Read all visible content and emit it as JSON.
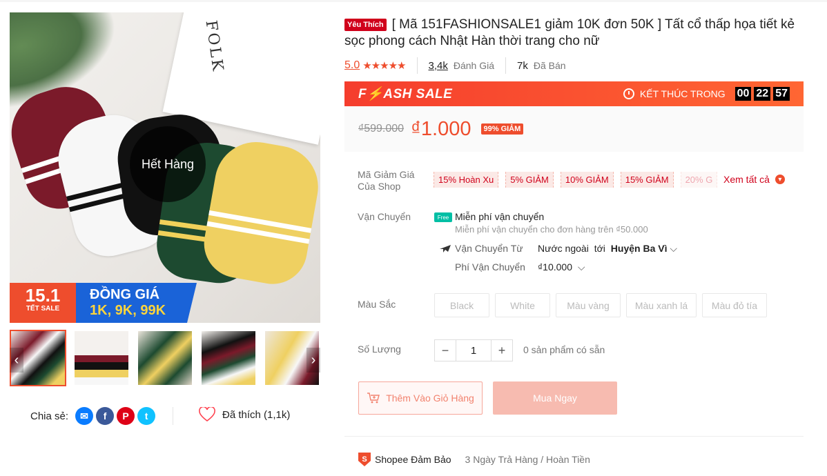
{
  "product": {
    "badge": "Yêu Thích",
    "title": "[ Mã 151FASHIONSALE1 giảm 10K đơn 50K ] Tất cổ thấp họa tiết kẻ sọc phong cách Nhật Hàn thời trang cho nữ",
    "rating": "5.0",
    "stars": "★★★★★",
    "review_count": "3,4k",
    "review_label": "Đánh Giá",
    "sold_count": "7k",
    "sold_label": "Đã Bán"
  },
  "image": {
    "out_of_stock": "Hết Hàng",
    "frame_text": "FOLK",
    "banner_big": "15.1",
    "banner_small": "TẾT SALE",
    "banner_l1": "ĐỒNG GIÁ",
    "banner_l2": "1K, 9K, 99K"
  },
  "flash_sale": {
    "label": "F⚡ASH SALE",
    "ends_label": "KẾT THÚC TRONG",
    "hours": "00",
    "minutes": "22",
    "seconds": "57"
  },
  "price": {
    "original": "₫599.000",
    "current": "₫1.000",
    "discount": "99% GIẢM"
  },
  "vouchers": {
    "label": "Mã Giảm Giá Của Shop",
    "items": [
      "15% Hoàn Xu",
      "5% GIẢM",
      "10% GIẢM",
      "15% GIẢM",
      "20% G"
    ],
    "see_all": "Xem tất cả"
  },
  "shipping": {
    "label": "Vận Chuyển",
    "free_icon": "Free",
    "free_title": "Miễn phí vận chuyển",
    "free_sub": "Miễn phí vận chuyển cho đơn hàng trên ₫50.000",
    "from_label": "Vận Chuyển Từ",
    "from_value": "Nước ngoài",
    "to_prefix": "tới",
    "to_value": "Huyện Ba Vì",
    "fee_label": "Phí Vận Chuyển",
    "fee_value": "₫10.000"
  },
  "colors": {
    "label": "Màu Sắc",
    "options": [
      "Black",
      "White",
      "Màu vàng",
      "Màu xanh lá",
      "Màu đỏ tía"
    ]
  },
  "quantity": {
    "label": "Số Lượng",
    "value": "1",
    "minus": "−",
    "plus": "+",
    "available": "0 sản phẩm có sẵn"
  },
  "actions": {
    "add_to_cart": "Thêm Vào Giỏ Hàng",
    "buy_now": "Mua Ngay"
  },
  "share": {
    "label": "Chia sẻ:",
    "liked": "Đã thích (1,1k)"
  },
  "guarantee": {
    "title": "Shopee Đảm Bảo",
    "desc": "3 Ngày Trả Hàng / Hoàn Tiền"
  },
  "colors_theme": {
    "brand": "#ee4d2d",
    "favorite_badge": "#d0011b"
  }
}
